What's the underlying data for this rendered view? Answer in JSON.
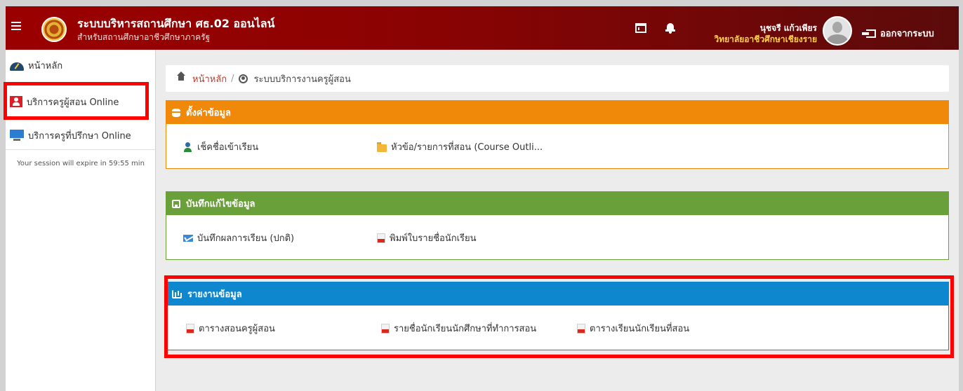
{
  "header": {
    "menu_icon": "hamburger-icon",
    "title": "ระบบบริหารสถานศึกษา ศธ.02 ออนไลน์",
    "subtitle": "สำหรับสถานศึกษาอาชีวศึกษาภาครัฐ",
    "calendar_icon": "calendar-icon",
    "bell_icon": "bell-icon",
    "user_name": "นุชจรี แก้วเพียร",
    "user_college": "วิทยาลัยอาชีวศึกษาเชียงราย",
    "logout_label": "ออกจากระบบ",
    "colors": {
      "header_left": "#9b0000",
      "header_right": "#5b0b0b",
      "college_text": "#ffd04a"
    }
  },
  "sidebar": {
    "items": [
      {
        "label": "หน้าหลัก",
        "icon": "dashboard-gauge-icon"
      },
      {
        "label": "บริการครูผู้สอน Online",
        "icon": "teacher-icon"
      },
      {
        "label": "บริการครูที่ปรึกษา Online",
        "icon": "monitor-icon"
      }
    ],
    "session_text": "Your session will expire in 59:55 min"
  },
  "breadcrumb": {
    "home": "หน้าหลัก",
    "separator": "/",
    "current": "ระบบบริการงานครูผู้สอน"
  },
  "panels": {
    "settings": {
      "title": "ตั้งค่าข้อมูล",
      "color": "#f0880a",
      "links": [
        "เช็คชื่อเข้าเรียน",
        "หัวข้อ/รายการที่สอน (Course Outli..."
      ]
    },
    "record": {
      "title": "บันทึกแก้ไขข้อมูล",
      "color": "#6aa03a",
      "links": [
        "บันทึกผลการเรียน (ปกติ)",
        "พิมพ์ใบรายชื่อนักเรียน"
      ]
    },
    "report": {
      "title": "รายงานข้อมูล",
      "color": "#0e87cf",
      "links": [
        "ตารางสอนครูผู้สอน",
        "รายชื่อนักเรียนนักศึกษาที่ทำการสอน",
        "ตารางเรียนนักเรียนที่สอน"
      ]
    }
  },
  "highlight_color": "#ff0000"
}
